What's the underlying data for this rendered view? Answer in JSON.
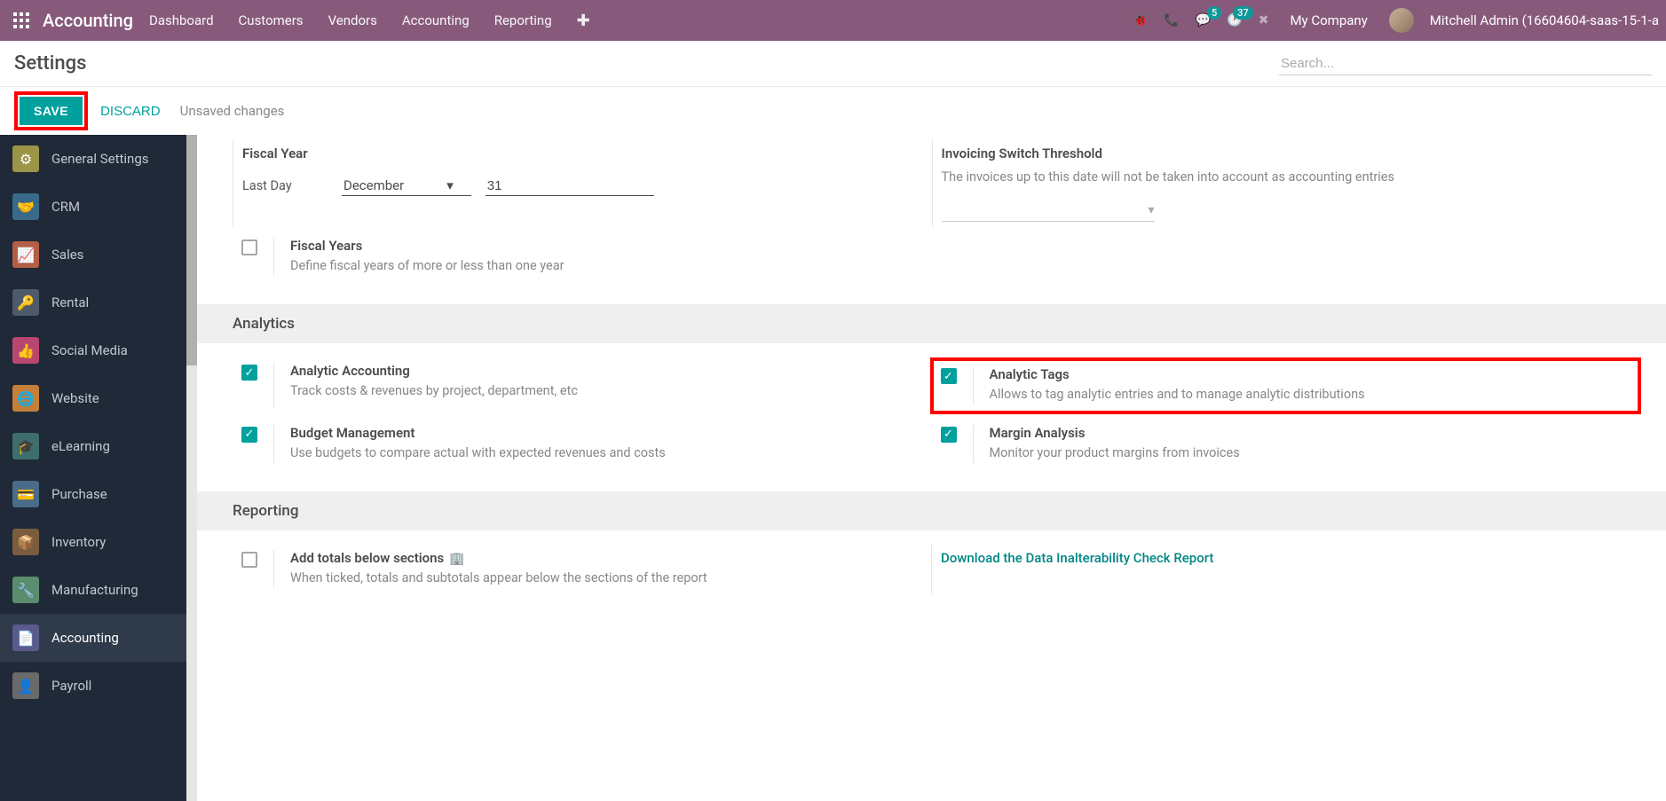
{
  "topbar": {
    "app_name": "Accounting",
    "nav": {
      "dashboard": "Dashboard",
      "customers": "Customers",
      "vendors": "Vendors",
      "accounting": "Accounting",
      "reporting": "Reporting"
    },
    "messages_badge": "5",
    "activities_badge": "37",
    "company": "My Company",
    "username": "Mitchell Admin (16604604-saas-15-1-a"
  },
  "subbar": {
    "title": "Settings",
    "search_placeholder": "Search..."
  },
  "actionbar": {
    "save": "SAVE",
    "discard": "DISCARD",
    "unsaved": "Unsaved changes"
  },
  "sidebar": {
    "items": [
      {
        "label": "General Settings"
      },
      {
        "label": "CRM"
      },
      {
        "label": "Sales"
      },
      {
        "label": "Rental"
      },
      {
        "label": "Social Media"
      },
      {
        "label": "Website"
      },
      {
        "label": "eLearning"
      },
      {
        "label": "Purchase"
      },
      {
        "label": "Inventory"
      },
      {
        "label": "Manufacturing"
      },
      {
        "label": "Accounting"
      },
      {
        "label": "Payroll"
      }
    ]
  },
  "fiscal": {
    "title": "Fiscal Year",
    "last_day_label": "Last Day",
    "month": "December",
    "day": "31",
    "fiscal_years_title": "Fiscal Years",
    "fiscal_years_desc": "Define fiscal years of more or less than one year"
  },
  "threshold": {
    "title": "Invoicing Switch Threshold",
    "desc": "The invoices up to this date will not be taken into account as accounting entries"
  },
  "analytics": {
    "header": "Analytics",
    "analytic_accounting_title": "Analytic Accounting",
    "analytic_accounting_desc": "Track costs & revenues by project, department, etc",
    "analytic_tags_title": "Analytic Tags",
    "analytic_tags_desc": "Allows to tag analytic entries and to manage analytic distributions",
    "budget_title": "Budget Management",
    "budget_desc": "Use budgets to compare actual with expected revenues and costs",
    "margin_title": "Margin Analysis",
    "margin_desc": "Monitor your product margins from invoices"
  },
  "reporting": {
    "header": "Reporting",
    "totals_title": "Add totals below sections",
    "totals_desc": "When ticked, totals and subtotals appear below the sections of the report",
    "download_link": "Download the Data Inalterability Check Report"
  }
}
